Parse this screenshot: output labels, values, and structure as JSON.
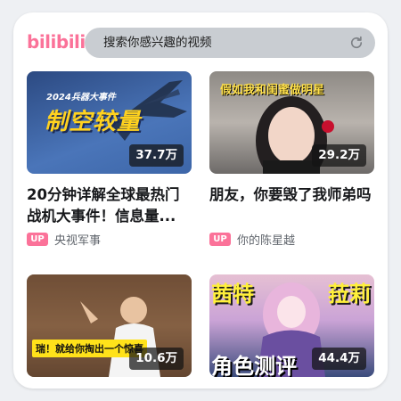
{
  "header": {
    "logo_text": "bilibili",
    "search_placeholder": "搜索你感兴趣的视频",
    "refresh_icon": "refresh-icon"
  },
  "videos": [
    {
      "thumb_caption_top": "2024兵器大事件",
      "thumb_caption": "制空较量",
      "views": "37.7万",
      "title": "20分钟详解全球最热门战机大事件！信息量...",
      "badge": "UP",
      "author": "央视军事"
    },
    {
      "thumb_caption": "假如我和闺蜜做明星",
      "views": "29.2万",
      "title": "朋友，你要毁了我师弟吗",
      "badge": "UP",
      "author": "你的陈星越"
    },
    {
      "thumb_caption": "瑞！就给你掏出一个惊喜",
      "views": "10.6万",
      "title": "",
      "badge": "",
      "author": ""
    },
    {
      "thumb_caption_left": "茜特",
      "thumb_caption_right": "菈莉",
      "thumb_caption_bottom": "角色测评",
      "views": "44.4万",
      "title": "",
      "badge": "",
      "author": ""
    }
  ],
  "colors": {
    "brand_pink": "#fb7299",
    "search_bg": "#c9cdd2"
  }
}
